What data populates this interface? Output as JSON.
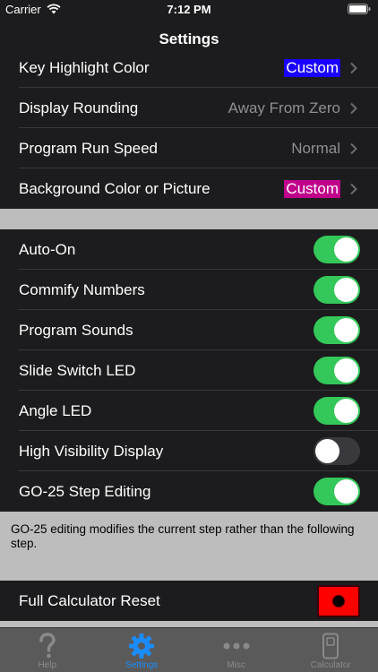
{
  "status": {
    "carrier": "Carrier",
    "time": "7:12 PM"
  },
  "nav": {
    "title": "Settings"
  },
  "rows_top": [
    {
      "label": "Key Highlight Color",
      "value": "Custom",
      "badge_color": "#1a00ff"
    },
    {
      "label": "Display Rounding",
      "value": "Away From Zero"
    },
    {
      "label": "Program Run Speed",
      "value": "Normal"
    },
    {
      "label": "Background Color or Picture",
      "value": "Custom",
      "badge_color": "#c0008a"
    }
  ],
  "toggles": [
    {
      "label": "Auto-On",
      "on": true
    },
    {
      "label": "Commify Numbers",
      "on": true
    },
    {
      "label": "Program Sounds",
      "on": true
    },
    {
      "label": "Slide Switch LED",
      "on": true
    },
    {
      "label": "Angle LED",
      "on": true
    },
    {
      "label": "High Visibility Display",
      "on": false
    },
    {
      "label": "GO-25 Step Editing",
      "on": true
    }
  ],
  "footer_note": "GO-25 editing modifies the current step rather than the following step.",
  "reset": {
    "label": "Full Calculator Reset"
  },
  "tabs": [
    {
      "label": "Help",
      "icon": "question-icon",
      "active": false
    },
    {
      "label": "Settings",
      "icon": "gear-icon",
      "active": true
    },
    {
      "label": "Misc",
      "icon": "ellipsis-icon",
      "active": false
    },
    {
      "label": "Calculator",
      "icon": "calculator-icon",
      "active": false
    }
  ],
  "colors": {
    "accent": "#1a8cff",
    "toggle_on": "#34c759",
    "reset": "#ff0000"
  }
}
